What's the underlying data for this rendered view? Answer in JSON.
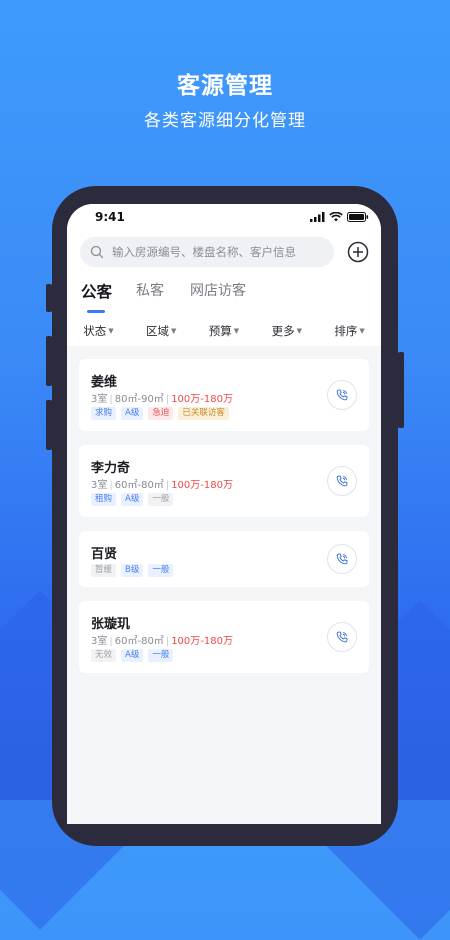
{
  "hero": {
    "title": "客源管理",
    "subtitle": "各类客源细分化管理"
  },
  "status_bar": {
    "time": "9:41"
  },
  "search": {
    "placeholder": "输入房源编号、楼盘名称、客户信息"
  },
  "tabs": [
    {
      "label": "公客",
      "active": true
    },
    {
      "label": "私客",
      "active": false
    },
    {
      "label": "网店访客",
      "active": false
    }
  ],
  "filters": [
    "状态",
    "区域",
    "预算",
    "更多",
    "排序"
  ],
  "customers": [
    {
      "name": "姜维",
      "rooms": "3室",
      "area": "80㎡-90㎡",
      "price": "100万-180万",
      "tags": [
        {
          "text": "求购",
          "color": "blue"
        },
        {
          "text": "A级",
          "color": "blue"
        },
        {
          "text": "急迫",
          "color": "red"
        },
        {
          "text": "已关联访客",
          "color": "gold"
        }
      ]
    },
    {
      "name": "李力奇",
      "rooms": "3室",
      "area": "60㎡-80㎡",
      "price": "100万-180万",
      "tags": [
        {
          "text": "租购",
          "color": "blue"
        },
        {
          "text": "A级",
          "color": "blue"
        },
        {
          "text": "一般",
          "color": "gray"
        }
      ]
    },
    {
      "name": "百贤",
      "tags": [
        {
          "text": "暂缓",
          "color": "gray"
        },
        {
          "text": "B级",
          "color": "blue"
        },
        {
          "text": "一般",
          "color": "blue"
        }
      ]
    },
    {
      "name": "张璇玑",
      "rooms": "3室",
      "area": "60㎡-80㎡",
      "price": "100万-180万",
      "tags": [
        {
          "text": "无效",
          "color": "gray"
        },
        {
          "text": "A级",
          "color": "blue"
        },
        {
          "text": "一般",
          "color": "blue"
        }
      ]
    }
  ],
  "icons": {
    "search": "search-icon",
    "add": "plus-circle-icon",
    "call": "phone-icon",
    "signal": "signal-icon",
    "wifi": "wifi-icon",
    "battery": "battery-icon"
  },
  "colors": {
    "accent": "#3a7bf5",
    "price": "#f04848",
    "background": "#3f9bfb"
  }
}
